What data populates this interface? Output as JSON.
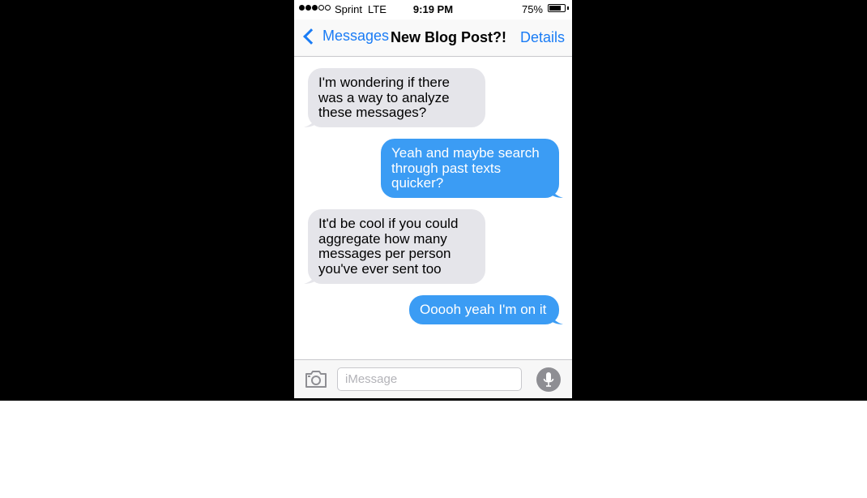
{
  "status_bar": {
    "carrier": "Sprint",
    "network": "LTE",
    "time": "9:19 PM",
    "battery_percent": "75%",
    "battery_level": 0.75,
    "signal_bars": 3
  },
  "nav": {
    "back_label": "Messages",
    "title": "New Blog Post?!",
    "details_label": "Details"
  },
  "messages": [
    {
      "direction": "incoming",
      "text": "I'm wondering if there was a way to analyze these messages?"
    },
    {
      "direction": "outgoing",
      "text": "Yeah and maybe search through past texts quicker?"
    },
    {
      "direction": "incoming",
      "text": "It'd be cool if you could aggregate how many messages per person you've ever sent too"
    },
    {
      "direction": "outgoing",
      "text": "Ooooh yeah I'm on it"
    }
  ],
  "input_bar": {
    "placeholder": "iMessage",
    "value": "",
    "camera_icon": "camera-icon",
    "mic_icon": "microphone-icon"
  },
  "colors": {
    "accent": "#1a7cf5",
    "outgoing_bubble": "#3b9cf4",
    "incoming_bubble": "#e5e5ea",
    "backdrop": "#000000"
  }
}
